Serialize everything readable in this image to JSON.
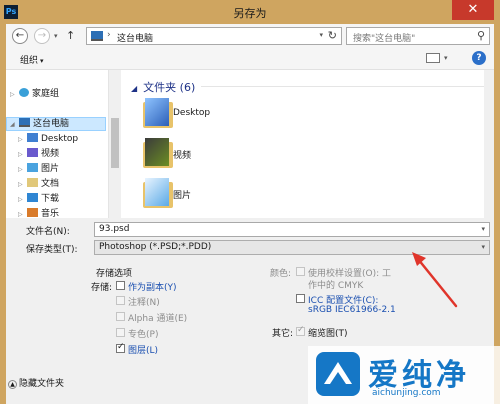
{
  "window": {
    "app_icon": "Ps",
    "title": "另存为",
    "close": "✕"
  },
  "nav": {
    "back": "←",
    "forward": "→",
    "up": "↑",
    "address_separator": "›",
    "location": "这台电脑",
    "refresh": "↻",
    "search_placeholder": "搜索\"这台电脑\"",
    "search_icon": "⚲"
  },
  "toolbar": {
    "organize": "组织",
    "help": "?"
  },
  "sidebar": {
    "items": [
      {
        "label": "家庭组"
      },
      {
        "label": "这台电脑"
      },
      {
        "label": "Desktop"
      },
      {
        "label": "视频"
      },
      {
        "label": "图片"
      },
      {
        "label": "文档"
      },
      {
        "label": "下载"
      },
      {
        "label": "音乐"
      }
    ]
  },
  "main": {
    "group_header": "文件夹 (6)",
    "folders": [
      {
        "name": "Desktop"
      },
      {
        "name": "视频"
      },
      {
        "name": "图片"
      }
    ]
  },
  "fields": {
    "filename_label": "文件名(N):",
    "filename_value": "93.psd",
    "filetype_label": "保存类型(T):",
    "filetype_value": "Photoshop (*.PSD;*.PDD)"
  },
  "options": {
    "section_title": "存储选项",
    "store_label": "存储:",
    "as_copy": "作为副本(Y)",
    "notes": "注释(N)",
    "alpha": "Alpha 通道(E)",
    "spot": "专色(P)",
    "layers": "图层(L)",
    "color_label": "颜色:",
    "proof_line1": "使用校样设置(O): 工",
    "proof_line2": "作中的 CMYK",
    "icc_line1": "ICC 配置文件(C):",
    "icc_line2": "sRGB IEC61966-2.1",
    "other_label": "其它:",
    "thumbnail": "缩览图(T)"
  },
  "footer": {
    "hide_folders": "隐藏文件夹"
  },
  "watermark": {
    "brand": "爱纯净",
    "url": "aichunjing.com"
  },
  "colors": {
    "title_bar": "#cfa560",
    "close_button": "#c7392b",
    "selection": "#cce8ff",
    "link": "#1a4fb0",
    "annotation_arrow": "#e0352b",
    "watermark": "#1577c6"
  }
}
